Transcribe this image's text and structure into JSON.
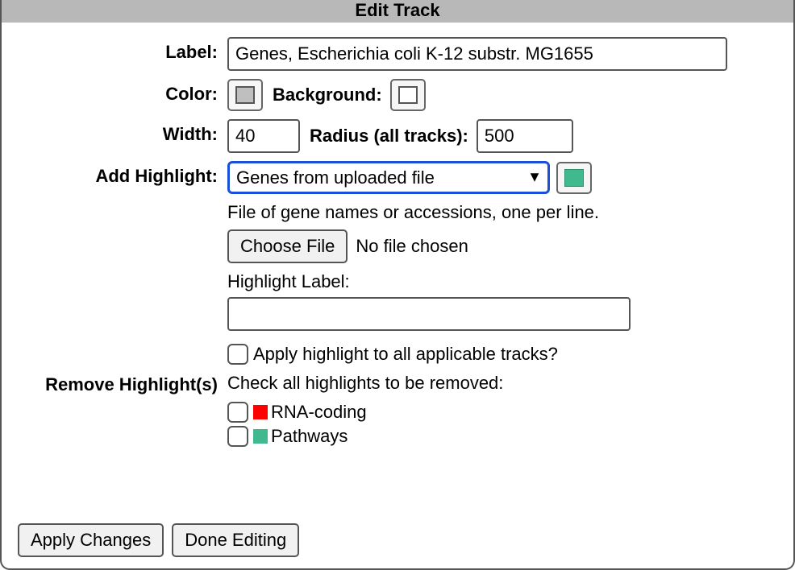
{
  "title": "Edit Track",
  "labels": {
    "label": "Label:",
    "color": "Color:",
    "background": "Background:",
    "width": "Width:",
    "radius": "Radius (all tracks):",
    "add_highlight": "Add Highlight:",
    "remove_highlights": "Remove Highlight(s)"
  },
  "fields": {
    "label_value": "Genes, Escherichia coli K-12 substr. MG1655",
    "color_swatch": "#bfbfbf",
    "background_swatch": "#ffffff",
    "width_value": "40",
    "radius_value": "500",
    "highlight_select_value": "Genes from uploaded file",
    "highlight_swatch": "#3fb98d",
    "file_helper": "File of gene names or accessions, one per line.",
    "choose_file_label": "Choose File",
    "file_status": "No file chosen",
    "highlight_label_label": "Highlight Label:",
    "highlight_label_value": "",
    "apply_all_label": "Apply highlight to all applicable tracks?",
    "remove_instruction": "Check all highlights to be removed:",
    "highlights": [
      {
        "name": "RNA-coding",
        "color": "#ff0000"
      },
      {
        "name": "Pathways",
        "color": "#3fb98d"
      }
    ]
  },
  "buttons": {
    "apply": "Apply Changes",
    "done": "Done Editing"
  }
}
